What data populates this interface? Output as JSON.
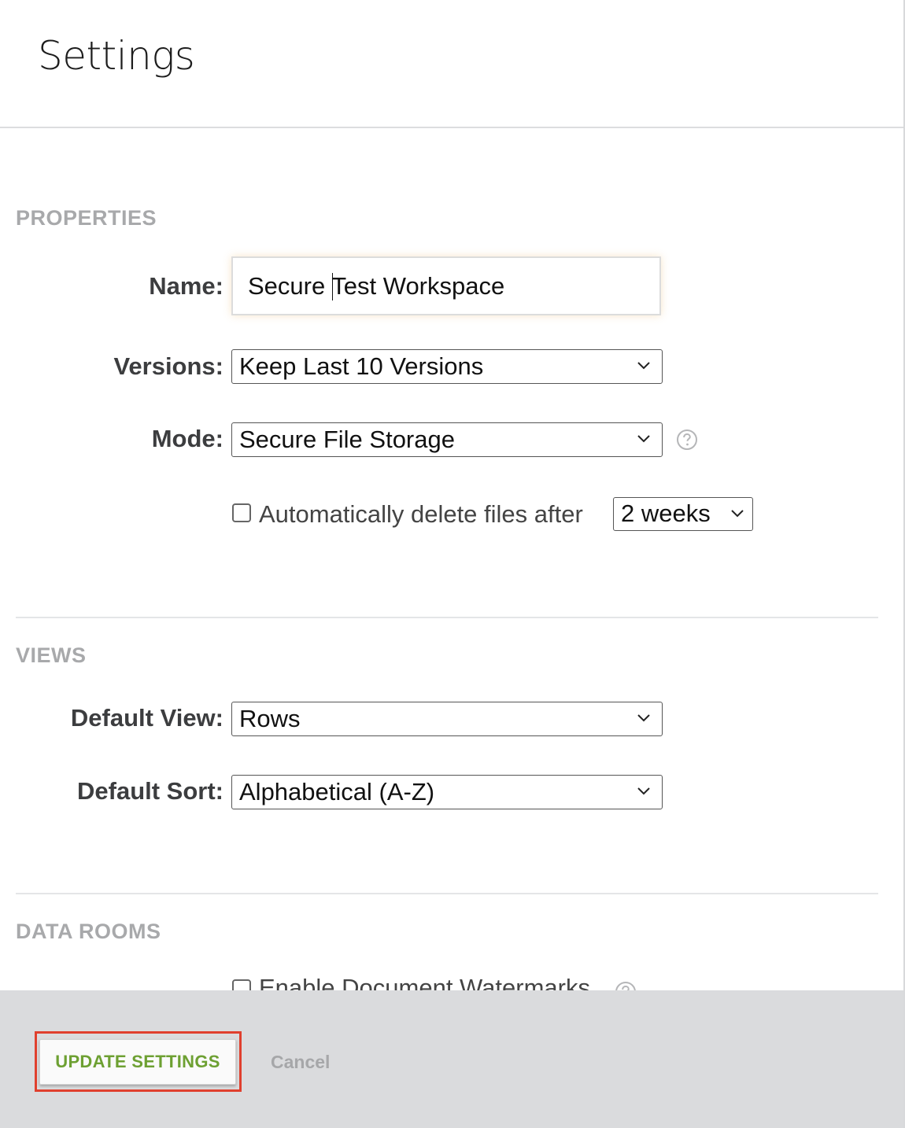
{
  "header": {
    "title": "Settings"
  },
  "properties": {
    "heading": "PROPERTIES",
    "name_label": "Name:",
    "name_value": "Secure Test Workspace",
    "versions_label": "Versions:",
    "versions_value": "Keep Last 10 Versions",
    "mode_label": "Mode:",
    "mode_value": "Secure File Storage",
    "auto_delete_label": "Automatically delete files after",
    "auto_delete_checked": false,
    "auto_delete_period": "2 weeks"
  },
  "views": {
    "heading": "VIEWS",
    "default_view_label": "Default View:",
    "default_view_value": "Rows",
    "default_sort_label": "Default Sort:",
    "default_sort_value": "Alphabetical (A-Z)"
  },
  "data_rooms": {
    "heading": "DATA ROOMS",
    "watermarks_label": "Enable Document Watermarks",
    "watermarks_checked": false
  },
  "footer": {
    "update_label": "UPDATE SETTINGS",
    "cancel_label": "Cancel"
  },
  "colors": {
    "accent_green": "#6da032",
    "highlight_red": "#e0402e",
    "footer_bg": "#dadbdd"
  },
  "icons": {
    "select_arrow": "chevron-down-icon",
    "help": "question-circle-icon"
  }
}
